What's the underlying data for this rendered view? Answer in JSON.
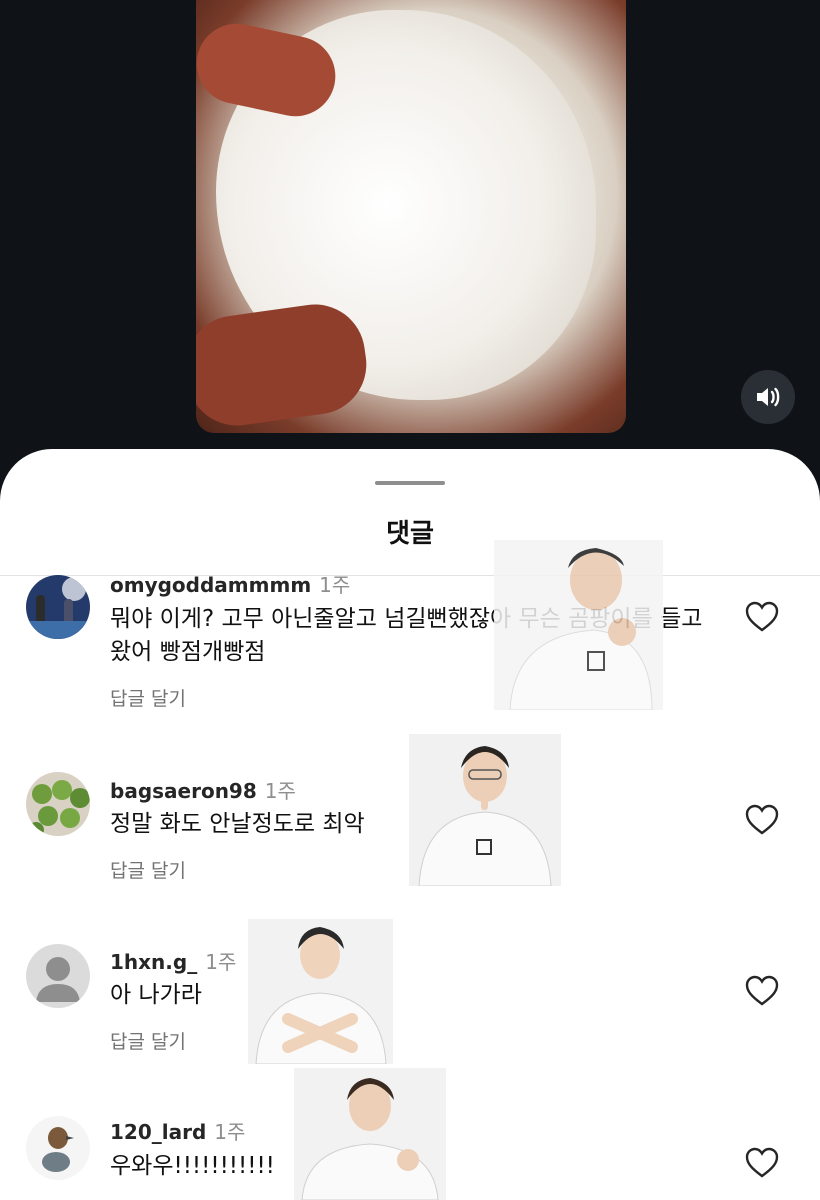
{
  "sheet": {
    "title": "댓글"
  },
  "icons": {
    "sound": "speaker-icon",
    "like": "heart-icon"
  },
  "colors": {
    "background": "#0f1317",
    "sheet": "#ffffff",
    "muted": "#8e8e8e"
  },
  "comments": [
    {
      "username": "omygoddammmm",
      "time": "1주",
      "text": "뭐야 이게? 고무 아닌줄알고 넘길뻔했잖아 무슨 곰팡이를 들고왔어 빵점개빵점",
      "reply": "답글 달기"
    },
    {
      "username": "bagsaeron98",
      "time": "1주",
      "text": "정말 화도 안날정도로 최악",
      "reply": "답글 달기"
    },
    {
      "username": "1hxn.g_",
      "time": "1주",
      "text": "아 나가라",
      "reply": "답글 달기"
    },
    {
      "username": "120_lard",
      "time": "1주",
      "text": "우와우!!!!!!!!!!!",
      "reply": ""
    }
  ]
}
